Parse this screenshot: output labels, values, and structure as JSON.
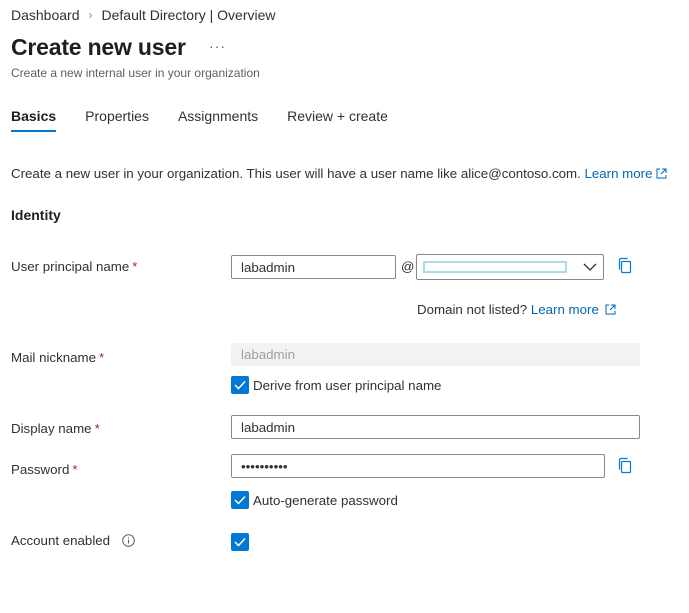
{
  "breadcrumb": {
    "home": "Dashboard",
    "current": "Default Directory | Overview",
    "separator": "›"
  },
  "header": {
    "title": "Create new user",
    "more": "···",
    "subtitle": "Create a new internal user in your organization"
  },
  "tabs": [
    {
      "label": "Basics",
      "active": true
    },
    {
      "label": "Properties",
      "active": false
    },
    {
      "label": "Assignments",
      "active": false
    },
    {
      "label": "Review + create",
      "active": false
    }
  ],
  "intro": {
    "text": "Create a new user in your organization. This user will have a user name like alice@contoso.com.",
    "link": "Learn more"
  },
  "identity": {
    "heading": "Identity"
  },
  "upn": {
    "label": "User principal name",
    "required": "*",
    "value": "labadmin",
    "at": "@"
  },
  "domain_hint": {
    "text": "Domain not listed?",
    "link": "Learn more"
  },
  "mail": {
    "label": "Mail nickname",
    "required": "*",
    "value": "labadmin",
    "derive_label": "Derive from user principal name",
    "derive_checked": true
  },
  "display": {
    "label": "Display name",
    "required": "*",
    "value": "labadmin"
  },
  "password": {
    "label": "Password",
    "required": "*",
    "value": "••••••••••",
    "auto_label": "Auto-generate password",
    "auto_checked": true
  },
  "account": {
    "label": "Account enabled",
    "checked": true
  },
  "colors": {
    "accent": "#0078d4",
    "link": "#0067b8",
    "required": "#a4262c",
    "redacted": "#a9dde8"
  }
}
